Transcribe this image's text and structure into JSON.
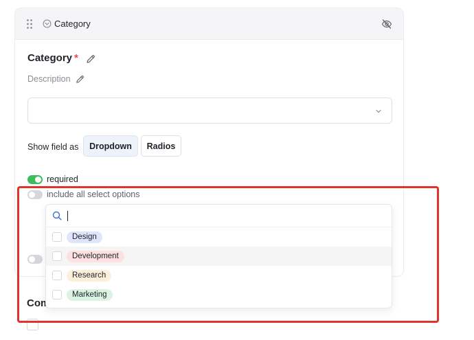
{
  "card": {
    "header_title": "Category",
    "field_title": "Category",
    "required_marker": "*",
    "description_placeholder": "Description",
    "select_value": "",
    "show_field_as_label": "Show field as",
    "display_options": [
      "Dropdown",
      "Radios"
    ],
    "selected_display": "Dropdown"
  },
  "toggles": {
    "required": {
      "label": "required",
      "on": true
    },
    "include_all": {
      "label": "include all select options",
      "on": false
    },
    "third": {
      "on": false
    }
  },
  "dropdown": {
    "search_value": "",
    "options": [
      {
        "label": "Design",
        "color": "#dfe6fb"
      },
      {
        "label": "Development",
        "color": "#fde1e0"
      },
      {
        "label": "Research",
        "color": "#fdf0db"
      },
      {
        "label": "Marketing",
        "color": "#dcf3e2"
      }
    ]
  },
  "below": {
    "title_partial": "Comp"
  },
  "colors": {
    "accent_green": "#3ebd5d",
    "highlight_red": "#e0332b",
    "required_red": "#e5484d"
  }
}
